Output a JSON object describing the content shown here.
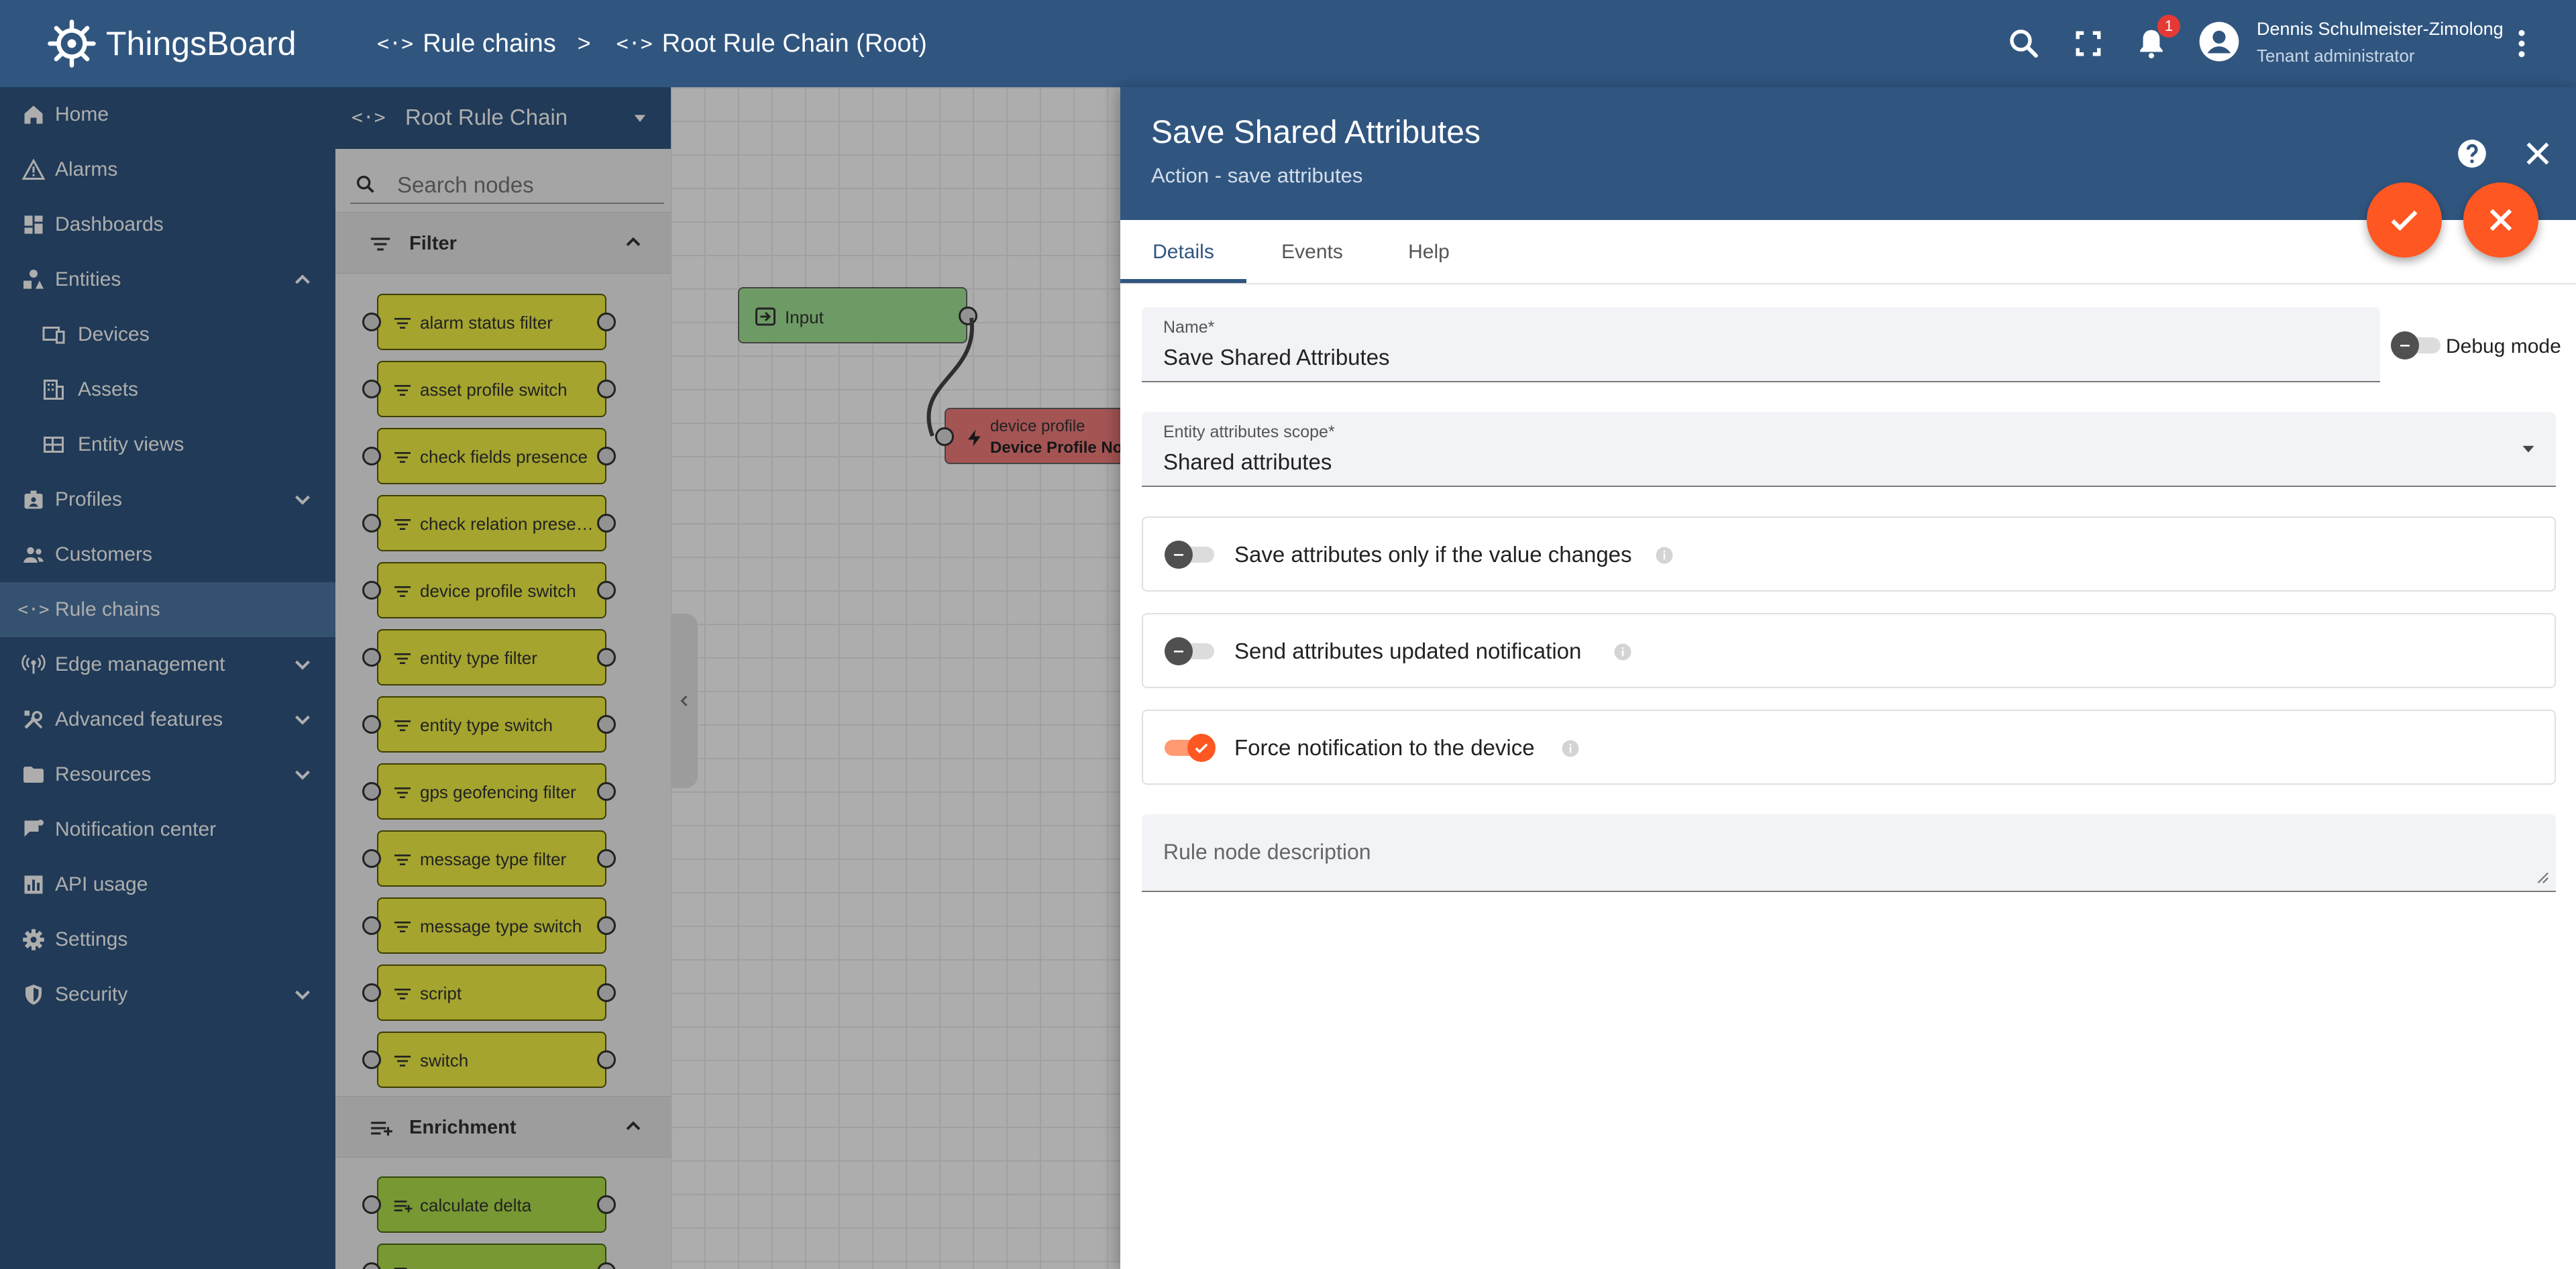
{
  "app": {
    "name": "ThingsBoard"
  },
  "breadcrumb": {
    "items": [
      {
        "label": "Rule chains"
      },
      {
        "label": "Root Rule Chain (Root)"
      }
    ],
    "separator": ">"
  },
  "header": {
    "notification_count": "1",
    "user_name": "Dennis Schulmeister-Zimolong",
    "user_role": "Tenant administrator"
  },
  "sidebar": {
    "items": [
      {
        "label": "Home",
        "icon": "home-icon"
      },
      {
        "label": "Alarms",
        "icon": "warning-icon"
      },
      {
        "label": "Dashboards",
        "icon": "dashboard-icon"
      },
      {
        "label": "Entities",
        "icon": "entities-icon",
        "expanded": true
      },
      {
        "label": "Devices",
        "icon": "devices-icon"
      },
      {
        "label": "Assets",
        "icon": "assets-icon"
      },
      {
        "label": "Entity views",
        "icon": "entity-views-icon"
      },
      {
        "label": "Profiles",
        "icon": "profiles-icon"
      },
      {
        "label": "Customers",
        "icon": "customers-icon"
      },
      {
        "label": "Rule chains",
        "icon": "rule-chains-icon",
        "active": true
      },
      {
        "label": "Edge management",
        "icon": "edge-icon"
      },
      {
        "label": "Advanced features",
        "icon": "tools-icon"
      },
      {
        "label": "Resources",
        "icon": "folder-icon"
      },
      {
        "label": "Notification center",
        "icon": "notification-center-icon"
      },
      {
        "label": "API usage",
        "icon": "api-usage-icon"
      },
      {
        "label": "Settings",
        "icon": "gear-icon"
      },
      {
        "label": "Security",
        "icon": "shield-icon"
      }
    ]
  },
  "library": {
    "chain_name": "Root Rule Chain",
    "search_placeholder": "Search nodes",
    "sections": [
      {
        "label": "Filter"
      },
      {
        "label": "Enrichment"
      }
    ],
    "filter_nodes": [
      "alarm status filter",
      "asset profile switch",
      "check fields presence",
      "check relation presence",
      "device profile switch",
      "entity type filter",
      "entity type switch",
      "gps geofencing filter",
      "message type filter",
      "message type switch",
      "script",
      "switch"
    ],
    "enrichment_nodes": [
      "calculate delta",
      ""
    ]
  },
  "canvas": {
    "nodes": [
      {
        "label": "Input"
      },
      {
        "type": "device profile",
        "name": "Device Profile Node"
      }
    ]
  },
  "details": {
    "title": "Save Shared Attributes",
    "subtitle": "Action - save attributes",
    "tabs": [
      {
        "label": "Details"
      },
      {
        "label": "Events"
      },
      {
        "label": "Help"
      }
    ],
    "name_label": "Name*",
    "name_value": "Save Shared Attributes",
    "debug_label": "Debug mode",
    "scope_label": "Entity attributes scope*",
    "scope_value": "Shared attributes",
    "options": [
      {
        "label": "Save attributes only if the value changes",
        "checked": false
      },
      {
        "label": "Send attributes updated notification",
        "checked": false
      },
      {
        "label": "Force notification to the device",
        "checked": true
      }
    ],
    "description_placeholder": "Rule node description"
  },
  "colors": {
    "primary": "#305680",
    "accent": "#ff5722",
    "filter_node": "#f2f246",
    "enrichment_node": "#b0e04a",
    "input_node": "#a3e395",
    "profile_node": "#f47c7c"
  }
}
